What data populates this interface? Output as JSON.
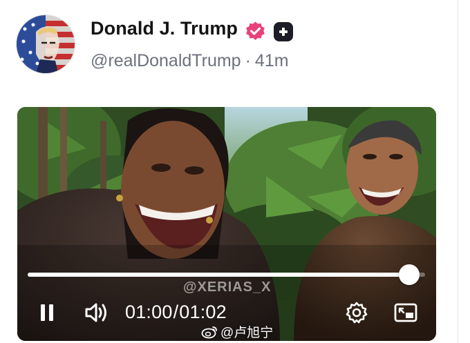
{
  "post": {
    "author": {
      "display_name": "Donald J. Trump",
      "handle": "@realDonaldTrump",
      "time_ago": "41m",
      "separator": "·",
      "verified_badge_color": "#e8417a",
      "avatar_icon": "avatar-flag-portrait"
    }
  },
  "video": {
    "overlay_watermark": "@XERIAS_X",
    "current_time": "01:00",
    "time_separator": "/",
    "duration": "01:02",
    "progress_fraction": 0.96,
    "state": "playing",
    "controls": {
      "pause_icon": "pause-icon",
      "volume_icon": "volume-icon",
      "settings_icon": "settings-gear-icon",
      "pip_icon": "picture-in-picture-icon"
    }
  },
  "image_watermark": {
    "text": "@卢旭宁",
    "icon": "weibo-logo-icon"
  }
}
